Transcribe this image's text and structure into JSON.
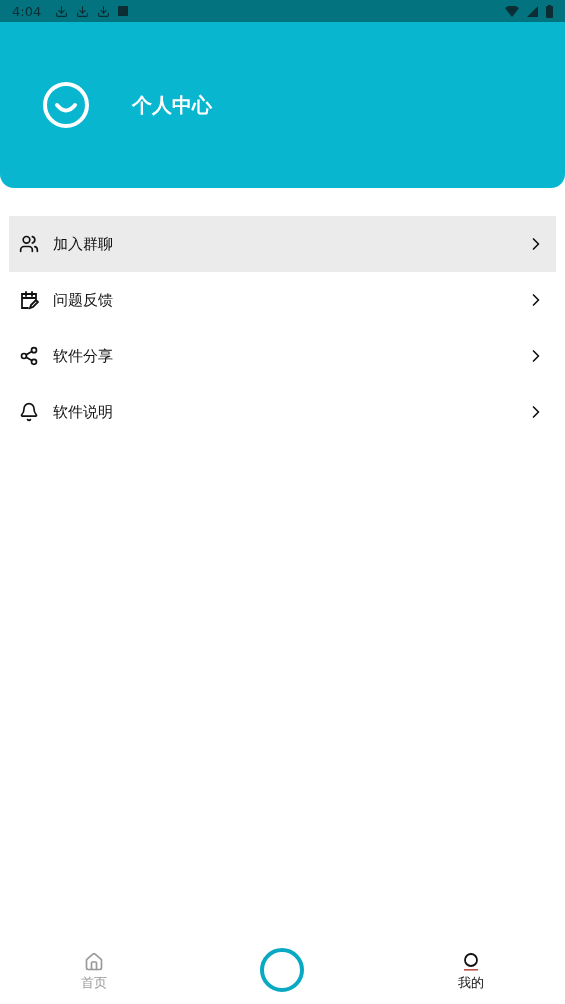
{
  "status_bar": {
    "time": "4:04"
  },
  "header": {
    "title": "个人中心"
  },
  "menu": [
    {
      "label": "加入群聊",
      "kind": "people",
      "selected": true
    },
    {
      "label": "问题反馈",
      "kind": "calendar-edit",
      "selected": false
    },
    {
      "label": "软件分享",
      "kind": "share",
      "selected": false
    },
    {
      "label": "软件说明",
      "kind": "bell",
      "selected": false
    }
  ],
  "bottom_nav": [
    {
      "label": "首页",
      "kind": "home",
      "selected": false
    },
    {
      "kind": "center"
    },
    {
      "label": "我的",
      "kind": "profile",
      "selected": true
    }
  ]
}
